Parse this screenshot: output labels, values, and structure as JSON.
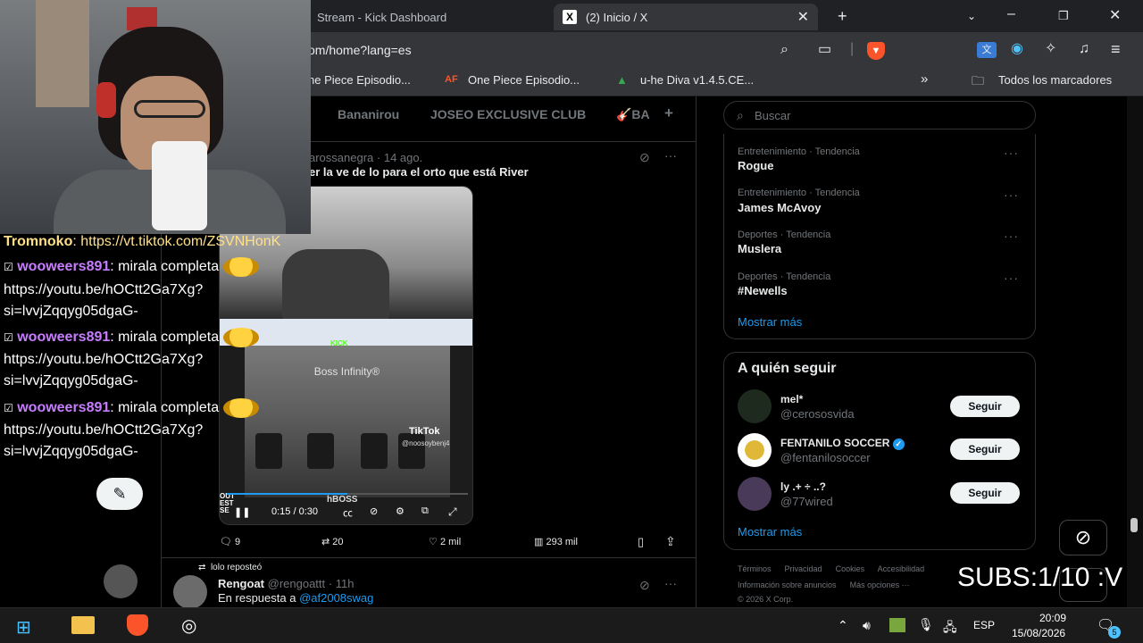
{
  "browser": {
    "tabs": [
      {
        "label": "Stream - Kick Dashboard"
      },
      {
        "label": "(2) Inicio / X"
      }
    ],
    "url": "om/home?lang=es",
    "bookmarks": [
      {
        "label": "ne Piece Episodio..."
      },
      {
        "label": "One Piece Episodio..."
      },
      {
        "label": "u-he Diva v1.4.5.CE..."
      }
    ],
    "bookmark_badge": "AF",
    "more_bookmarks": "»",
    "all_bookmarks": "Todos los marcadores"
  },
  "feed": {
    "tabs": [
      "Bananirou",
      "JOSEO EXCLUSIVE CLUB",
      "🎸BA"
    ],
    "add_tab": "+",
    "post1": {
      "author": "arossanegra",
      "date": "· 14 ago.",
      "text": "er la ve de lo para el orto que está River",
      "video": {
        "overlay_title": "Boss Infinity®",
        "tiktok_label": "TikTok",
        "tiktok_handle": "@noosoybenj4",
        "kick_label": "KICK",
        "time": "0:15 / 0:30",
        "corner_text": "OUT",
        "corner_text2": "EST",
        "corner_text3": "SE",
        "brand": "hBOSS"
      },
      "replies": "9",
      "reposts": "20",
      "likes": "2 mil",
      "views": "293 mil"
    },
    "post2": {
      "repost_label": "lolo reposteó",
      "author": "Rengoat",
      "handle": "@rengoattt",
      "date": "· 11h",
      "reply_prefix": "En respuesta a",
      "reply_to": "@af2008swag"
    }
  },
  "sidebar": {
    "search_placeholder": "Buscar",
    "trends": [
      {
        "category": "Entretenimiento · Tendencia",
        "name": "Rogue"
      },
      {
        "category": "Entretenimiento · Tendencia",
        "name": "James McAvoy"
      },
      {
        "category": "Deportes · Tendencia",
        "name": "Muslera"
      },
      {
        "category": "Deportes · Tendencia",
        "name": "#Newells"
      }
    ],
    "show_more": "Mostrar más",
    "who_to_follow_title": "A quién seguir",
    "follow_suggestions": [
      {
        "name": "mel*",
        "handle": "@cerososvida",
        "button": "Seguir"
      },
      {
        "name": "FENTANILO SOCCER",
        "handle": "@fentanilosoccer",
        "button": "Seguir"
      },
      {
        "name": "ly .+ ÷ ..?",
        "handle": "@77wired",
        "button": "Seguir"
      }
    ],
    "show_more_follow": "Mostrar más",
    "footer": {
      "row1": [
        "Términos",
        "Privacidad",
        "Cookies",
        "Accesibilidad"
      ],
      "row2": [
        "Información sobre anuncios",
        "Más opciones ···"
      ],
      "copyright": "© 2026 X Corp."
    }
  },
  "overlay": {
    "chat": [
      {
        "prefix": "",
        "user": "Tromnoko",
        "text": ": https://vt.tiktok.com/ZSVNHonK"
      },
      {
        "prefix": "☑",
        "user": "wooweers891",
        "text": ": mirala completa"
      },
      {
        "prefix": "",
        "user": "",
        "text": "https://youtu.be/hOCtt2Ga7Xg?"
      },
      {
        "prefix": "",
        "user": "",
        "text": "si=lvvjZqqyg05dgaG-"
      },
      {
        "prefix": "☑",
        "user": "wooweers891",
        "text": ": mirala completa"
      },
      {
        "prefix": "",
        "user": "",
        "text": "https://youtu.be/hOCtt2Ga7Xg?"
      },
      {
        "prefix": "",
        "user": "",
        "text": "si=lvvjZqqyg05dgaG-"
      },
      {
        "prefix": "☑",
        "user": "wooweers891",
        "text": ": mirala completa"
      },
      {
        "prefix": "",
        "user": "",
        "text": "https://youtu.be/hOCtt2Ga7Xg?"
      },
      {
        "prefix": "",
        "user": "",
        "text": "si=lvvjZqqyg05dgaG-"
      }
    ],
    "subs": "SUBS:1/10 :V"
  },
  "taskbar": {
    "language": "ESP",
    "time": "20:09",
    "date": "15/08/2026",
    "notif_count": "5"
  },
  "colors": {
    "x_blue": "#1d9bf0",
    "x_bg": "#000000",
    "chat_user": "#c77dff",
    "brave_orange": "#fb542b"
  }
}
